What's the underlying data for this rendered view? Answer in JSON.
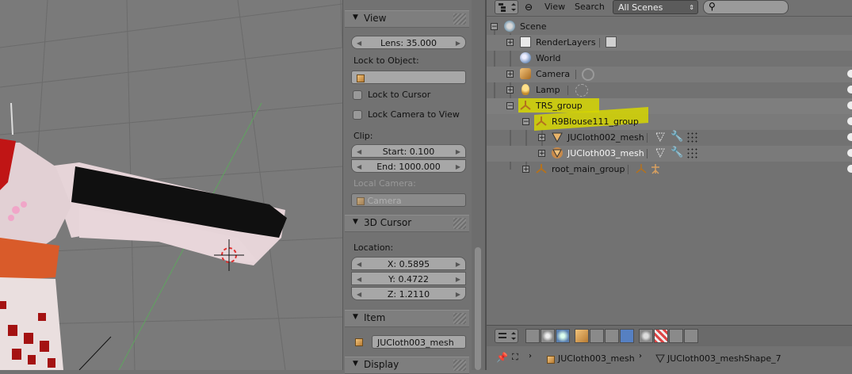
{
  "properties": {
    "view_panel": {
      "title": "View",
      "lens": "Lens: 35.000",
      "lock_to_object_label": "Lock to Object:",
      "lock_to_cursor": "Lock to Cursor",
      "lock_camera_to_view": "Lock Camera to View",
      "clip_label": "Clip:",
      "clip_start": "Start: 0.100",
      "clip_end": "End: 1000.000",
      "local_camera_label": "Local Camera:",
      "local_camera_value": "Camera"
    },
    "cursor_panel": {
      "title": "3D Cursor",
      "location_label": "Location:",
      "x": "X: 0.5895",
      "y": "Y: 0.4722",
      "z": "Z: 1.2110"
    },
    "item_panel": {
      "title": "Item",
      "name": "JUCloth003_mesh"
    },
    "display_panel": {
      "title": "Display"
    }
  },
  "outliner": {
    "menu_view": "View",
    "menu_search": "Search",
    "scene_filter": "All Scenes",
    "rows": [
      {
        "label": "Scene"
      },
      {
        "label": "RenderLayers"
      },
      {
        "label": "World"
      },
      {
        "label": "Camera"
      },
      {
        "label": "Lamp"
      },
      {
        "label": "TRS_group"
      },
      {
        "label": "R9Blouse111_group"
      },
      {
        "label": "JUCloth002_mesh"
      },
      {
        "label": "JUCloth003_mesh"
      },
      {
        "label": "root_main_group"
      }
    ],
    "status_object": "JUCloth003_mesh",
    "status_data": "JUCloth003_meshShape_7"
  },
  "colors": {
    "highlight": "#d6d600",
    "active_button": "#5680c2"
  }
}
